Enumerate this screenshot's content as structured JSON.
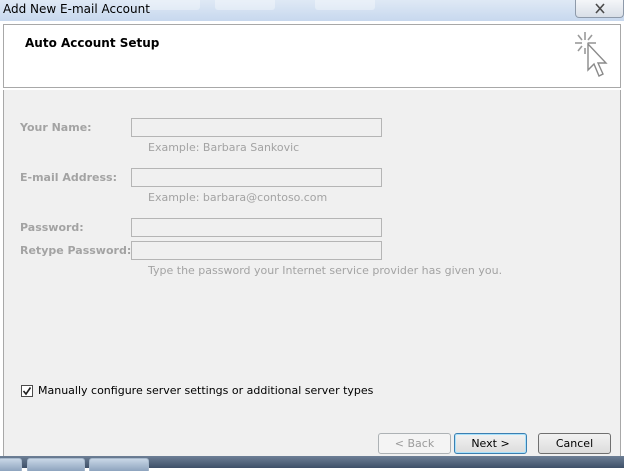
{
  "window": {
    "title": "Add New E-mail Account",
    "close_icon": "close-icon"
  },
  "header": {
    "title": "Auto Account Setup",
    "icon": "cursor-sparkle-icon"
  },
  "form": {
    "name_label": "Your Name:",
    "name_value": "",
    "name_hint": "Example: Barbara Sankovic",
    "email_label": "E-mail Address:",
    "email_value": "",
    "email_hint": "Example: barbara@contoso.com",
    "password_label": "Password:",
    "password_value": "",
    "retype_label": "Retype Password:",
    "retype_value": "",
    "password_hint": "Type the password your Internet service provider has given you."
  },
  "manual_config": {
    "label": "Manually configure server settings or additional server types",
    "checked": true
  },
  "buttons": {
    "back": "< Back",
    "next": "Next >",
    "cancel": "Cancel"
  }
}
